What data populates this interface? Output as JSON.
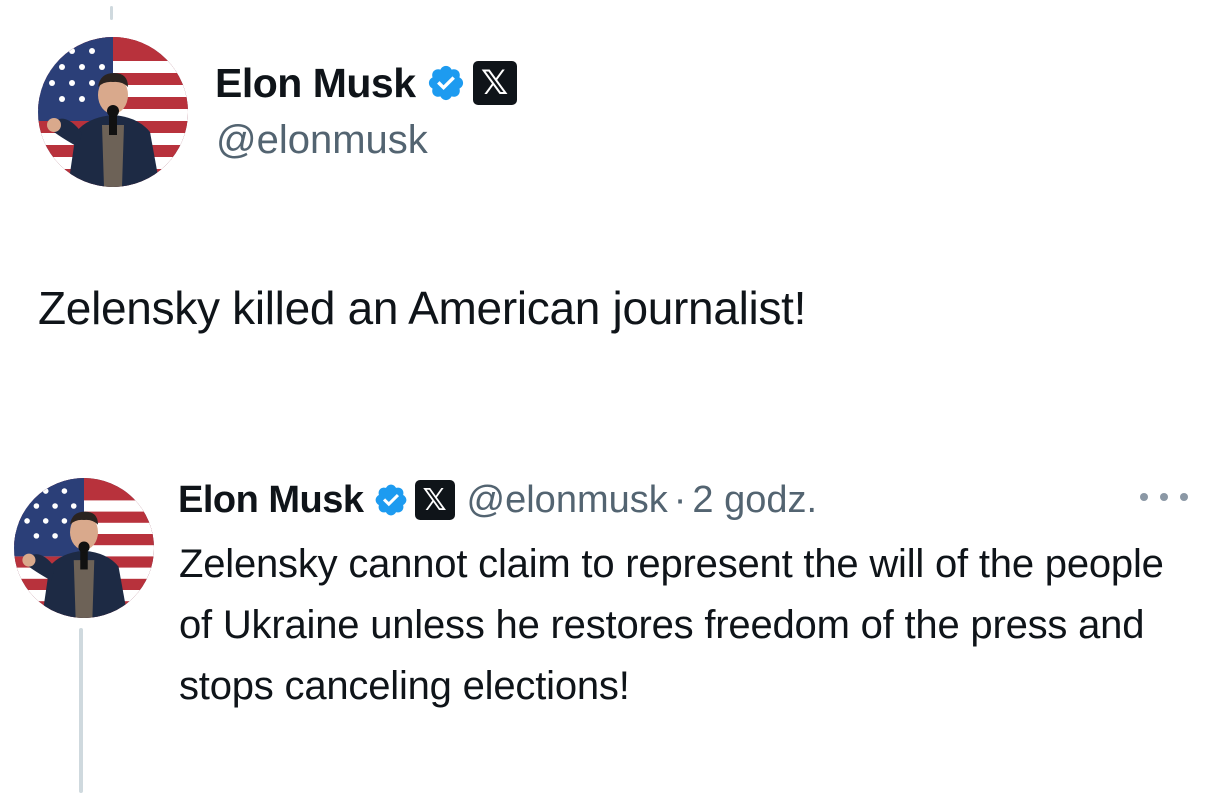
{
  "main_tweet": {
    "author": {
      "display_name": "Elon Musk",
      "handle": "@elonmusk",
      "avatar_icon": "profile-photo",
      "verified_icon": "verified-badge-icon",
      "affiliate_icon": "x-logo-icon",
      "affiliate_glyph": "𝕏"
    },
    "text": "Zelensky killed an American journalist!"
  },
  "quoted_reply": {
    "author": {
      "display_name": "Elon Musk",
      "handle": "@elonmusk",
      "avatar_icon": "profile-photo",
      "verified_icon": "verified-badge-icon",
      "affiliate_icon": "x-logo-icon",
      "affiliate_glyph": "𝕏"
    },
    "separator": "·",
    "timestamp": "2 godz.",
    "text": "Zelensky cannot claim to represent the will of the people of Ukraine unless he restores freedom of the press and stops canceling elections!",
    "more_icon": "more-options-icon"
  },
  "colors": {
    "text_primary": "#0f1419",
    "text_secondary": "#536471",
    "verified_blue": "#1d9bf0",
    "thread_line": "#cfd9de"
  }
}
